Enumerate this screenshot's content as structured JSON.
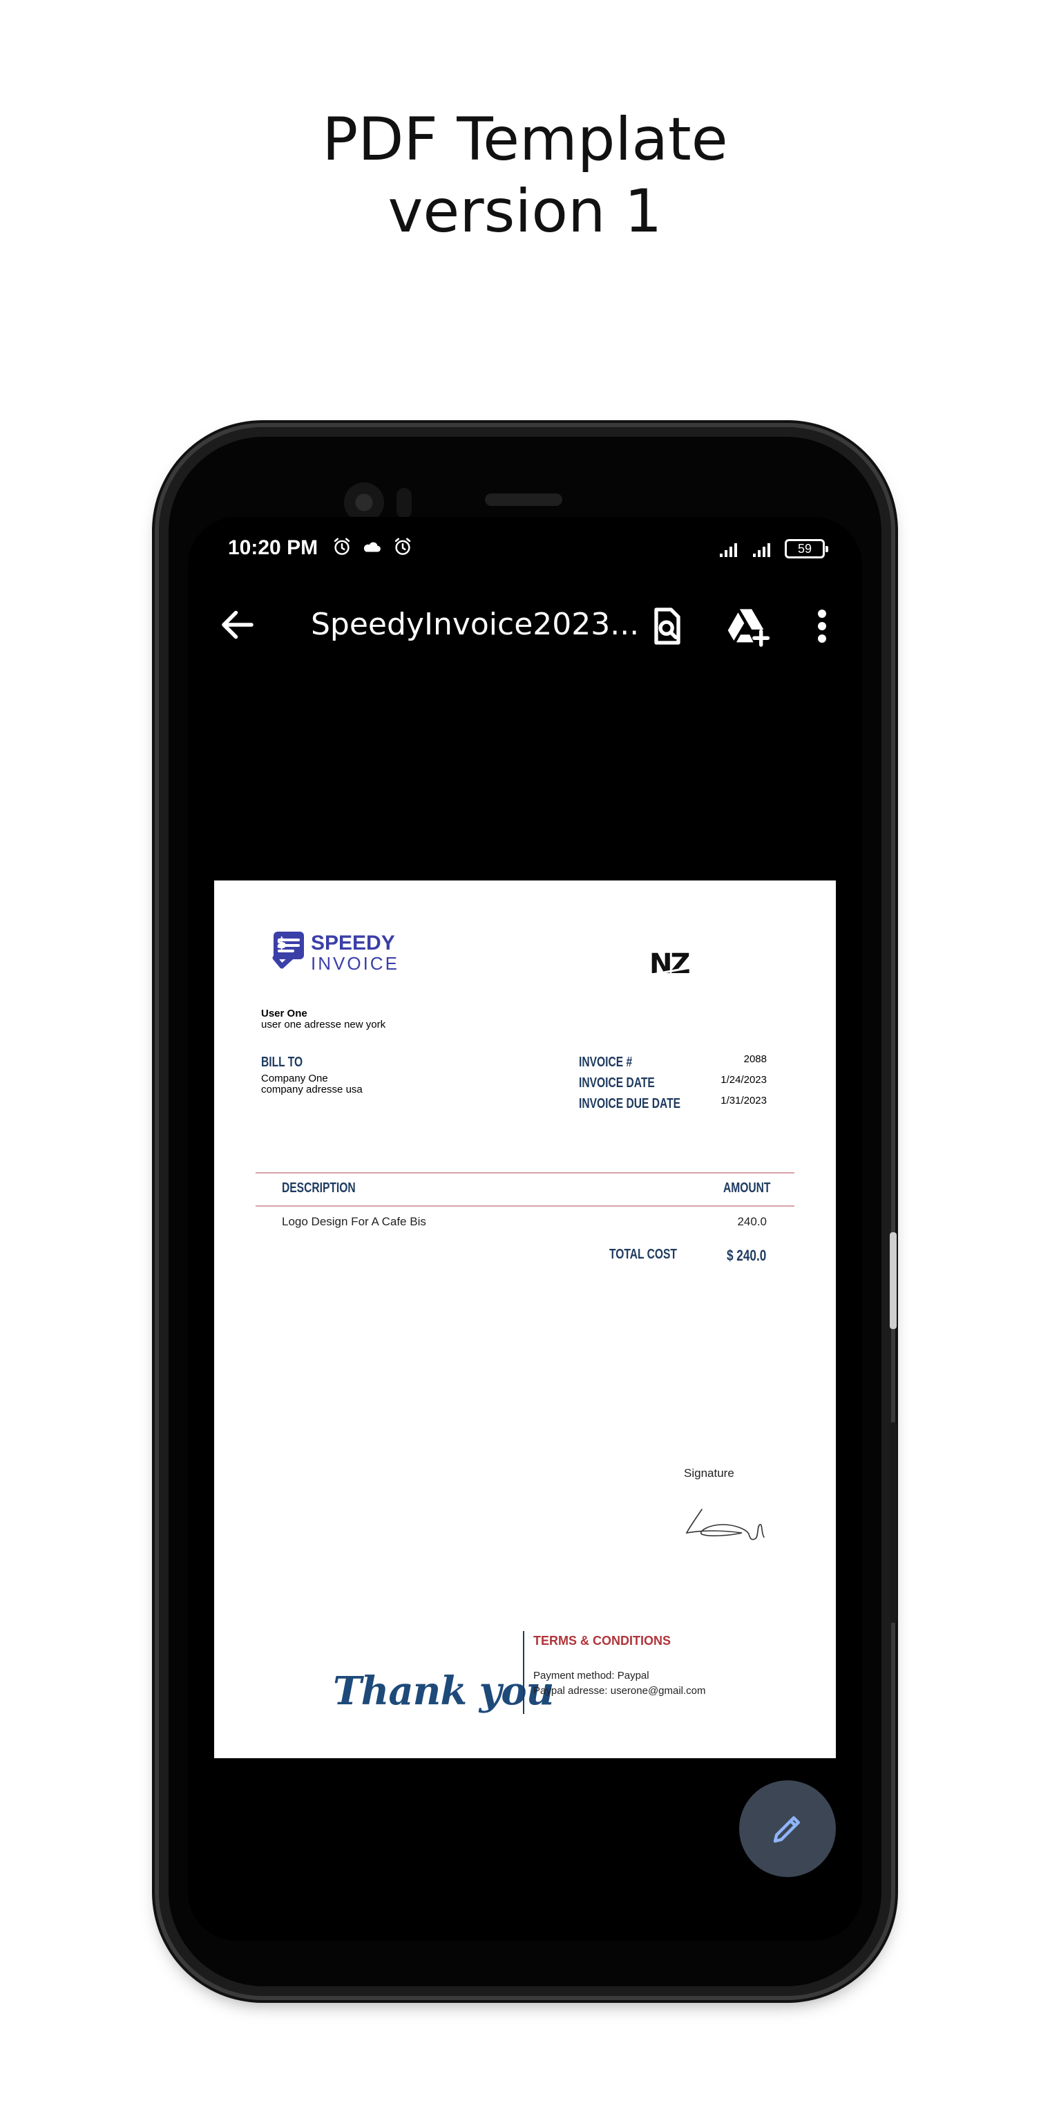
{
  "caption": {
    "line1": "PDF Template",
    "line2": "version 1"
  },
  "status_bar": {
    "time": "10:20 PM",
    "left_icons": [
      "alarm-icon",
      "cloud-icon",
      "alarm-icon"
    ],
    "battery": "59"
  },
  "app_bar": {
    "title": "SpeedyInvoice2023...",
    "actions": [
      "search-document-icon",
      "drive-add-icon",
      "more-vert-icon"
    ]
  },
  "invoice": {
    "logo": {
      "line1": "SPEEDY",
      "line2": "INVOICE",
      "mark": "NZ"
    },
    "sender": {
      "name": "User One",
      "address": "user one adresse new york"
    },
    "bill_to": {
      "label": "BILL TO",
      "company": "Company One",
      "address": "company adresse usa"
    },
    "meta": {
      "number_label": "INVOICE #",
      "number": "2088",
      "date_label": "INVOICE DATE",
      "date": "1/24/2023",
      "due_label": "INVOICE DUE DATE",
      "due": "1/31/2023"
    },
    "table": {
      "headers": {
        "description": "DESCRIPTION",
        "amount": "AMOUNT"
      },
      "rows": [
        {
          "description": "Logo Design For A Cafe Bis",
          "amount": "240.0"
        }
      ],
      "total_label": "TOTAL COST",
      "total_value": "$ 240.0"
    },
    "signature_label": "Signature",
    "thank_you": "Thank you",
    "terms": {
      "title": "TERMS & CONDITIONS",
      "payment_method": "Payment method: Paypal",
      "payment_address": "Paypal adresse: userone@gmail.com"
    }
  },
  "colors": {
    "accent_navy": "#1e3a5f",
    "terms_red": "#b0343a",
    "rule_pink": "#d8a3a9",
    "logo_blue": "#3b3fa8",
    "fab_bg": "#3d4654",
    "fab_icon": "#8fb4f8"
  }
}
